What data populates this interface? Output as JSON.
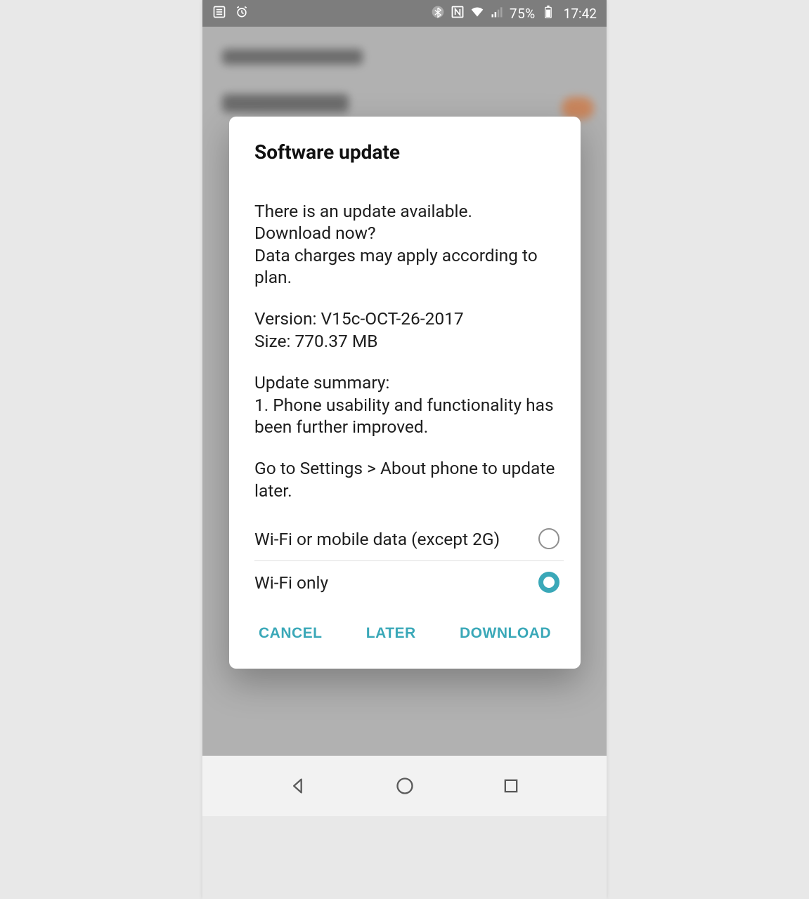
{
  "status_bar": {
    "battery_pct": "75%",
    "time": "17:42",
    "icons": [
      "list-icon",
      "alarm-icon",
      "bluetooth-icon",
      "nfc-icon",
      "wifi-icon",
      "signal-icon",
      "battery-icon"
    ]
  },
  "dialog": {
    "title": "Software update",
    "body": {
      "intro_line1": "There is an update available.",
      "intro_line2": "Download now?",
      "intro_line3": "Data charges may apply according to plan.",
      "version_label": "Version:",
      "version_value": "V15c-OCT-26-2017",
      "size_label": "Size:",
      "size_value": "770.37 MB",
      "summary_header": "Update summary:",
      "summary_item1": "1. Phone usability and functionality has been further improved.",
      "later_hint": "Go to Settings > About phone to update later."
    },
    "radio_options": [
      {
        "label": "Wi-Fi or mobile data (except 2G)",
        "selected": false
      },
      {
        "label": "Wi-Fi only",
        "selected": true
      }
    ],
    "actions": {
      "cancel": "CANCEL",
      "later": "LATER",
      "download": "DOWNLOAD"
    }
  },
  "colors": {
    "accent": "#3aa8b8"
  }
}
